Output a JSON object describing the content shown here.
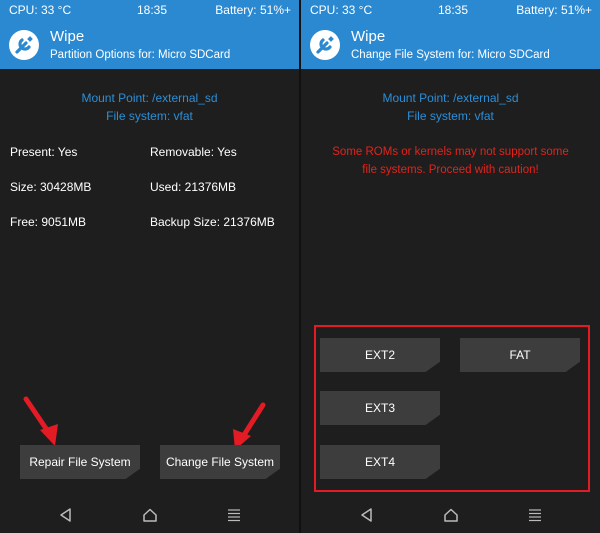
{
  "left": {
    "status": {
      "cpu": "CPU: 33 °C",
      "time": "18:35",
      "battery": "Battery: 51%+"
    },
    "header": {
      "title": "Wipe",
      "subtitle": "Partition Options for: Micro SDCard"
    },
    "mount_point": "Mount Point: /external_sd",
    "file_system": "File system: vfat",
    "props": {
      "present": "Present: Yes",
      "removable": "Removable: Yes",
      "size": "Size: 30428MB",
      "used": "Used: 21376MB",
      "free": "Free: 9051MB",
      "backup_size": "Backup Size: 21376MB"
    },
    "buttons": {
      "repair": "Repair File System",
      "change": "Change File System"
    }
  },
  "right": {
    "status": {
      "cpu": "CPU: 33 °C",
      "time": "18:35",
      "battery": "Battery: 51%+"
    },
    "header": {
      "title": "Wipe",
      "subtitle": "Change File System for: Micro SDCard"
    },
    "mount_point": "Mount Point: /external_sd",
    "file_system": "File system: vfat",
    "warning_line1": "Some ROMs or kernels may not support some",
    "warning_line2": "file systems. Proceed with caution!",
    "buttons": {
      "ext2": "EXT2",
      "fat": "FAT",
      "ext3": "EXT3",
      "ext4": "EXT4"
    }
  },
  "icons": {
    "logo": "twrp-logo-icon",
    "back": "back-triangle-icon",
    "home": "home-icon",
    "menu": "menu-icon",
    "arrow": "red-arrow-icon"
  },
  "colors": {
    "accent": "#2b89d2",
    "info_text": "#2b8fd8",
    "warning": "#e4231b",
    "highlight": "#e21b24",
    "button": "#3d3d3d",
    "background": "#1e1e1e"
  }
}
